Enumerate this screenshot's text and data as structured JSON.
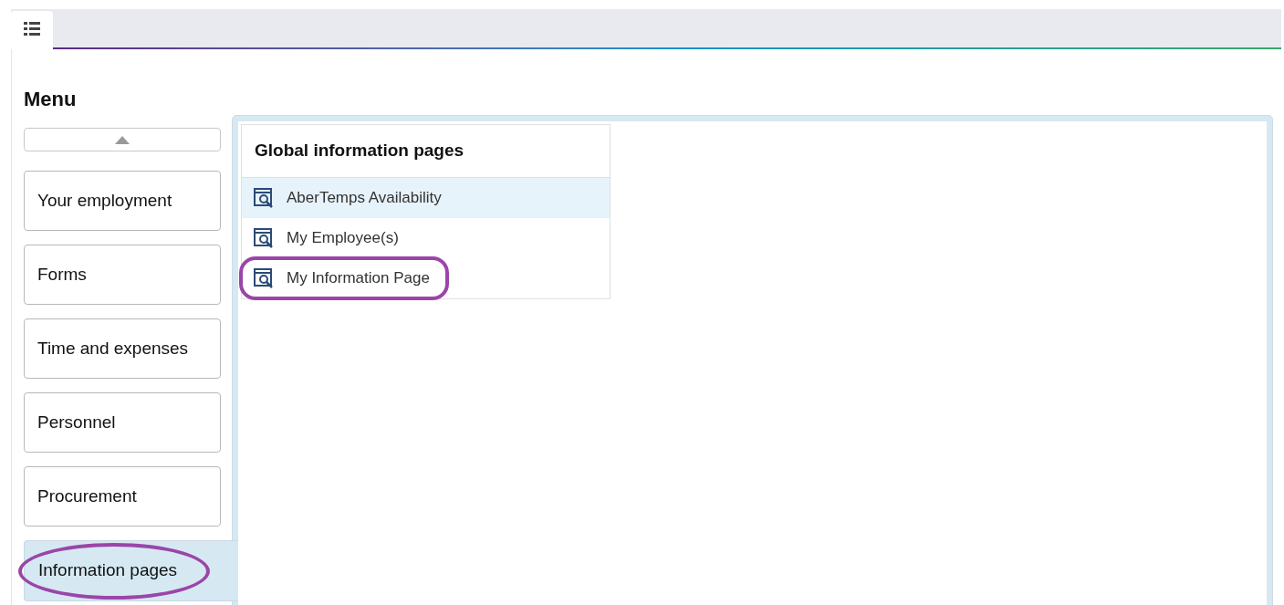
{
  "tabs": [
    {
      "kind": "list-icon",
      "selected": true
    }
  ],
  "menu": {
    "title": "Menu",
    "items": [
      {
        "label": "Your employment",
        "selected": false,
        "circled": false
      },
      {
        "label": "Forms",
        "selected": false,
        "circled": false
      },
      {
        "label": "Time and expenses",
        "selected": false,
        "circled": false
      },
      {
        "label": "Personnel",
        "selected": false,
        "circled": false
      },
      {
        "label": "Procurement",
        "selected": false,
        "circled": false
      },
      {
        "label": "Information pages",
        "selected": true,
        "circled": true
      }
    ]
  },
  "panel": {
    "title": "Global information pages",
    "items": [
      {
        "label": "AberTemps Availability",
        "selected": true,
        "circled": false
      },
      {
        "label": "My Employee(s)",
        "selected": false,
        "circled": false
      },
      {
        "label": "My Information Page",
        "selected": false,
        "circled": true
      }
    ]
  }
}
